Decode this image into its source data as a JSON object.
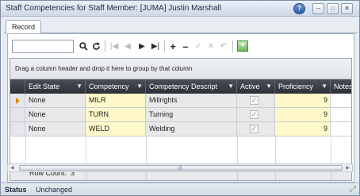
{
  "window": {
    "title": "Staff Competencies for Staff Member: [JUMA] Justin Marshall",
    "help": "?",
    "minimize": "–",
    "maximize": "□",
    "close": "✕"
  },
  "tabs": [
    {
      "label": "Record"
    }
  ],
  "toolbar": {
    "search_value": "",
    "icons": [
      "search-icon",
      "refresh-icon",
      "first-icon",
      "previous-icon",
      "next-icon",
      "last-icon",
      "add-icon",
      "remove-icon",
      "save-icon",
      "cancel-icon",
      "undo-icon",
      "add-record-icon"
    ]
  },
  "grid": {
    "group_hint": "Drag a column header and drop it here to group by that column",
    "columns": [
      "Edit State",
      "Competency",
      "Competency Descript",
      "Active",
      "Proficiency",
      "Notes"
    ],
    "rows": [
      {
        "edit_state": "None",
        "competency": "MILR",
        "description": "Millrights",
        "active": true,
        "proficiency": "9",
        "notes": ""
      },
      {
        "edit_state": "None",
        "competency": "TURN",
        "description": "Turning",
        "active": true,
        "proficiency": "9",
        "notes": ""
      },
      {
        "edit_state": "None",
        "competency": "WELD",
        "description": "Welding",
        "active": true,
        "proficiency": "9",
        "notes": ""
      }
    ],
    "row_count_label": "Row Count:",
    "row_count": "3"
  },
  "status": {
    "label": "Status",
    "value": "Unchanged"
  }
}
